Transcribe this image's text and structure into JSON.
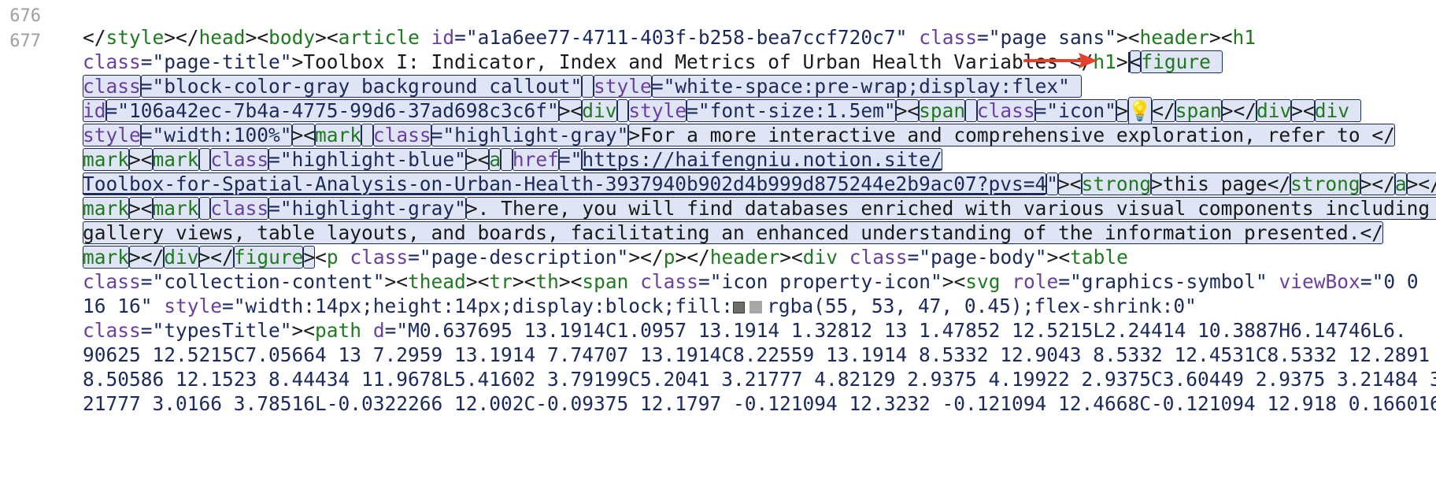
{
  "editor": {
    "line_numbers": [
      "676",
      "677"
    ],
    "lines": [
      [
        {
          "t": "</",
          "c": "punc"
        },
        {
          "t": "style",
          "c": "tag"
        },
        {
          "t": "></",
          "c": "punc"
        },
        {
          "t": "head",
          "c": "tag"
        },
        {
          "t": "><",
          "c": "punc"
        },
        {
          "t": "body",
          "c": "tag"
        },
        {
          "t": "><",
          "c": "punc"
        },
        {
          "t": "article",
          "c": "tag"
        },
        {
          "t": " ",
          "c": "text"
        },
        {
          "t": "id",
          "c": "attr"
        },
        {
          "t": "=\"a1a6ee77-4711-403f-b258-bea7ccf720c7\"",
          "c": "str"
        },
        {
          "t": " ",
          "c": "text"
        },
        {
          "t": "class",
          "c": "attr"
        },
        {
          "t": "=\"page sans\"",
          "c": "str"
        },
        {
          "t": "><",
          "c": "punc"
        },
        {
          "t": "header",
          "c": "tag"
        },
        {
          "t": "><",
          "c": "punc"
        },
        {
          "t": "h1",
          "c": "tag"
        }
      ],
      [
        {
          "t": "class",
          "c": "attr"
        },
        {
          "t": "=\"page-title\"",
          "c": "str"
        },
        {
          "t": ">Toolbox I: Indicator, Index and Metrics of Urban Health Variables </",
          "c": "text"
        },
        {
          "t": "h1",
          "c": "tag"
        },
        {
          "t": ">",
          "c": "punc"
        },
        {
          "t": "CARET",
          "c": "caret"
        },
        {
          "t": "<",
          "c": "sel-punc"
        },
        {
          "t": "figure ",
          "c": "sel-tag"
        }
      ],
      [
        {
          "t": "class",
          "c": "sel-attr"
        },
        {
          "t": "=\"block-color-gray_background callout\"",
          "c": "sel-str"
        },
        {
          "t": " ",
          "c": "sel-text"
        },
        {
          "t": "style",
          "c": "sel-attr"
        },
        {
          "t": "=\"white-space:pre-wrap;display:flex\" ",
          "c": "sel-str"
        }
      ],
      [
        {
          "t": "id",
          "c": "sel-attr"
        },
        {
          "t": "=\"106a42ec-7b4a-4775-99d6-37ad698c3c6f\"",
          "c": "sel-str"
        },
        {
          "t": "><",
          "c": "sel-punc"
        },
        {
          "t": "div",
          "c": "sel-tag"
        },
        {
          "t": " ",
          "c": "sel-text"
        },
        {
          "t": "style",
          "c": "sel-attr"
        },
        {
          "t": "=\"font-size:1.5em\"",
          "c": "sel-str"
        },
        {
          "t": "><",
          "c": "sel-punc"
        },
        {
          "t": "span",
          "c": "sel-tag"
        },
        {
          "t": " ",
          "c": "sel-text"
        },
        {
          "t": "class",
          "c": "sel-attr"
        },
        {
          "t": "=\"icon\"",
          "c": "sel-str"
        },
        {
          "t": ">",
          "c": "sel-punc"
        },
        {
          "t": "💡",
          "c": "sel-bulb"
        },
        {
          "t": "</",
          "c": "sel-punc"
        },
        {
          "t": "span",
          "c": "sel-tag"
        },
        {
          "t": "></",
          "c": "sel-punc"
        },
        {
          "t": "div",
          "c": "sel-tag"
        },
        {
          "t": "><",
          "c": "sel-punc"
        },
        {
          "t": "div ",
          "c": "sel-tag"
        }
      ],
      [
        {
          "t": "style",
          "c": "sel-attr"
        },
        {
          "t": "=\"width:100%\"",
          "c": "sel-str"
        },
        {
          "t": "><",
          "c": "sel-punc"
        },
        {
          "t": "mark",
          "c": "sel-tag"
        },
        {
          "t": " ",
          "c": "sel-text"
        },
        {
          "t": "class",
          "c": "sel-attr"
        },
        {
          "t": "=\"highlight-gray\"",
          "c": "sel-str"
        },
        {
          "t": ">For a more interactive and comprehensive exploration, refer to </",
          "c": "sel-text"
        }
      ],
      [
        {
          "t": "mark",
          "c": "sel-tag"
        },
        {
          "t": "><",
          "c": "sel-punc"
        },
        {
          "t": "mark",
          "c": "sel-tag"
        },
        {
          "t": " ",
          "c": "sel-text"
        },
        {
          "t": "class",
          "c": "sel-attr"
        },
        {
          "t": "=\"highlight-blue\"",
          "c": "sel-str"
        },
        {
          "t": "><",
          "c": "sel-punc"
        },
        {
          "t": "a",
          "c": "sel-tag"
        },
        {
          "t": " ",
          "c": "sel-text"
        },
        {
          "t": "href",
          "c": "sel-attr"
        },
        {
          "t": "=\"",
          "c": "sel-str"
        },
        {
          "t": "https://haifengniu.notion.site/",
          "c": "sel-str-under"
        }
      ],
      [
        {
          "t": "Toolbox-for-Spatial-Analysis-on-Urban-Health-3937940b902d4b999d875244e2b9ac07?pvs=4",
          "c": "sel-str-under"
        },
        {
          "t": "\"",
          "c": "sel-str"
        },
        {
          "t": "><",
          "c": "sel-punc"
        },
        {
          "t": "strong",
          "c": "sel-tag"
        },
        {
          "t": ">this page</",
          "c": "sel-text"
        },
        {
          "t": "strong",
          "c": "sel-tag"
        },
        {
          "t": "></",
          "c": "sel-punc"
        },
        {
          "t": "a",
          "c": "sel-tag"
        },
        {
          "t": "></",
          "c": "sel-punc"
        }
      ],
      [
        {
          "t": "mark",
          "c": "sel-tag"
        },
        {
          "t": "><",
          "c": "sel-punc"
        },
        {
          "t": "mark",
          "c": "sel-tag"
        },
        {
          "t": " ",
          "c": "sel-text"
        },
        {
          "t": "class",
          "c": "sel-attr"
        },
        {
          "t": "=\"highlight-gray\"",
          "c": "sel-str"
        },
        {
          "t": ">. There, you will find databases enriched with various visual components including ",
          "c": "sel-text"
        }
      ],
      [
        {
          "t": "gallery views, table layouts, and boards, facilitating an enhanced understanding of the information presented.</",
          "c": "sel-text"
        }
      ],
      [
        {
          "t": "mark",
          "c": "sel-tag"
        },
        {
          "t": "></",
          "c": "sel-punc"
        },
        {
          "t": "div",
          "c": "sel-tag"
        },
        {
          "t": "></",
          "c": "sel-punc"
        },
        {
          "t": "figure",
          "c": "sel-tag"
        },
        {
          "t": ">",
          "c": "sel-punc"
        },
        {
          "t": "<",
          "c": "punc"
        },
        {
          "t": "p",
          "c": "tag"
        },
        {
          "t": " ",
          "c": "text"
        },
        {
          "t": "class",
          "c": "attr"
        },
        {
          "t": "=\"page-description\"",
          "c": "str"
        },
        {
          "t": "></",
          "c": "punc"
        },
        {
          "t": "p",
          "c": "tag"
        },
        {
          "t": "></",
          "c": "punc"
        },
        {
          "t": "header",
          "c": "tag"
        },
        {
          "t": "><",
          "c": "punc"
        },
        {
          "t": "div",
          "c": "tag"
        },
        {
          "t": " ",
          "c": "text"
        },
        {
          "t": "class",
          "c": "attr"
        },
        {
          "t": "=\"page-body\"",
          "c": "str"
        },
        {
          "t": "><",
          "c": "punc"
        },
        {
          "t": "table",
          "c": "tag"
        }
      ],
      [
        {
          "t": "class",
          "c": "attr"
        },
        {
          "t": "=\"collection-content\"",
          "c": "str"
        },
        {
          "t": "><",
          "c": "punc"
        },
        {
          "t": "thead",
          "c": "tag"
        },
        {
          "t": "><",
          "c": "punc"
        },
        {
          "t": "tr",
          "c": "tag"
        },
        {
          "t": "><",
          "c": "punc"
        },
        {
          "t": "th",
          "c": "tag"
        },
        {
          "t": "><",
          "c": "punc"
        },
        {
          "t": "span",
          "c": "tag"
        },
        {
          "t": " ",
          "c": "text"
        },
        {
          "t": "class",
          "c": "attr"
        },
        {
          "t": "=\"icon property-icon\"",
          "c": "str"
        },
        {
          "t": "><",
          "c": "punc"
        },
        {
          "t": "svg",
          "c": "tag"
        },
        {
          "t": " ",
          "c": "text"
        },
        {
          "t": "role",
          "c": "attr"
        },
        {
          "t": "=\"graphics-symbol\"",
          "c": "str"
        },
        {
          "t": " ",
          "c": "text"
        },
        {
          "t": "viewBox",
          "c": "attr"
        },
        {
          "t": "=\"0 0",
          "c": "str"
        }
      ],
      [
        {
          "t": "16 16\"",
          "c": "str"
        },
        {
          "t": " ",
          "c": "text"
        },
        {
          "t": "style",
          "c": "attr"
        },
        {
          "t": "=\"width:14px;height:14px;display:block;fill:",
          "c": "str"
        },
        {
          "t": "SWATCH",
          "c": "swatch"
        },
        {
          "t": "rgba(55, 53, 47, 0.45);flex-shrink:0\"",
          "c": "str"
        }
      ],
      [
        {
          "t": "class",
          "c": "attr"
        },
        {
          "t": "=\"typesTitle\"",
          "c": "str"
        },
        {
          "t": "><",
          "c": "punc"
        },
        {
          "t": "path",
          "c": "tag"
        },
        {
          "t": " ",
          "c": "text"
        },
        {
          "t": "d",
          "c": "attr"
        },
        {
          "t": "=\"M0.637695 13.1914C1.0957 13.1914 1.32812 13 1.47852 12.5215L2.24414 10.3887H6.14746L6.",
          "c": "str"
        }
      ],
      [
        {
          "t": "90625 12.5215C7.05664 13 7.2959 13.1914 7.74707 13.1914C8.22559 13.1914 8.5332 12.9043 8.5332 12.4531C8.5332 12.2891",
          "c": "str"
        }
      ],
      [
        {
          "t": "8.50586 12.1523 8.44434 11.9678L5.41602 3.79199C5.2041 3.21777 4.82129 2.9375 4.19922 2.9375C3.60449 2.9375 3.21484 3.",
          "c": "str"
        }
      ],
      [
        {
          "t": "21777 3.0166 3.78516L-0.0322266 12.002C-0.09375 12.1797 -0.121094 12.3232 -0.121094 12.4668C-0.121094 12.918 0.166016",
          "c": "str"
        }
      ]
    ]
  }
}
